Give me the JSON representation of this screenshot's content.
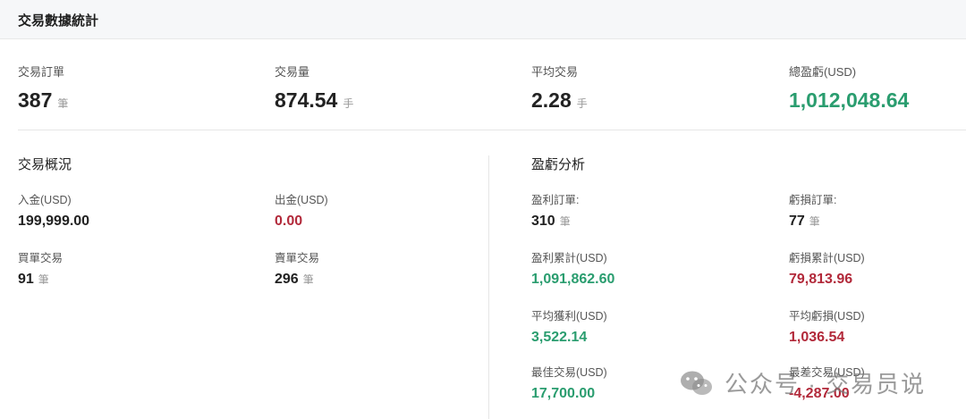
{
  "header": {
    "title": "交易數據統計"
  },
  "summary": [
    {
      "label": "交易訂單",
      "value": "387",
      "unit": "筆"
    },
    {
      "label": "交易量",
      "value": "874.54",
      "unit": "手"
    },
    {
      "label": "平均交易",
      "value": "2.28",
      "unit": "手"
    },
    {
      "label": "總盈虧(USD)",
      "value": "1,012,048.64",
      "unit": ""
    }
  ],
  "overview": {
    "title": "交易概況",
    "deposit": {
      "label": "入金(USD)",
      "value": "199,999.00"
    },
    "withdraw": {
      "label": "出金(USD)",
      "value": "0.00"
    },
    "buy": {
      "label": "買單交易",
      "value": "91",
      "unit": "筆"
    },
    "sell": {
      "label": "賣單交易",
      "value": "296",
      "unit": "筆"
    }
  },
  "pnl": {
    "title": "盈虧分析",
    "profit_orders": {
      "label": "盈利訂單:",
      "value": "310",
      "unit": "筆"
    },
    "loss_orders": {
      "label": "虧損訂單:",
      "value": "77",
      "unit": "筆"
    },
    "profit_total": {
      "label": "盈利累計(USD)",
      "value": "1,091,862.60"
    },
    "loss_total": {
      "label": "虧損累計(USD)",
      "value": "79,813.96"
    },
    "avg_profit": {
      "label": "平均獲利(USD)",
      "value": "3,522.14"
    },
    "avg_loss": {
      "label": "平均虧損(USD)",
      "value": "1,036.54"
    },
    "best_trade": {
      "label": "最佳交易(USD)",
      "value": "17,700.00"
    },
    "worst_trade": {
      "label": "最差交易(USD)",
      "value": "-4,287.00"
    }
  },
  "watermark": {
    "text": "公众号 · 交易员说",
    "icon": "wechat-icon"
  },
  "colors": {
    "profit": "#2a9d6f",
    "loss": "#b2293a",
    "header_bg": "#f6f7f9"
  }
}
